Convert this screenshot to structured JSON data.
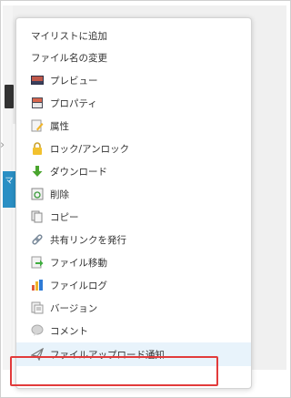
{
  "background": {
    "side_tab_label": "マ"
  },
  "menu": {
    "items": [
      {
        "label": "マイリストに追加",
        "icon": "none"
      },
      {
        "label": "ファイル名の変更",
        "icon": "none"
      },
      {
        "label": "プレビュー",
        "icon": "preview-icon"
      },
      {
        "label": "プロパティ",
        "icon": "properties-icon"
      },
      {
        "label": "属性",
        "icon": "attribute-icon"
      },
      {
        "label": "ロック/アンロック",
        "icon": "lock-icon"
      },
      {
        "label": "ダウンロード",
        "icon": "download-icon"
      },
      {
        "label": "削除",
        "icon": "delete-icon"
      },
      {
        "label": "コピー",
        "icon": "copy-icon"
      },
      {
        "label": "共有リンクを発行",
        "icon": "link-icon"
      },
      {
        "label": "ファイル移動",
        "icon": "move-icon"
      },
      {
        "label": "ファイルログ",
        "icon": "log-icon"
      },
      {
        "label": "バージョン",
        "icon": "version-icon"
      },
      {
        "label": "コメント",
        "icon": "comment-icon"
      },
      {
        "label": "ファイルアップロード通知",
        "icon": "upload-notify-icon"
      }
    ],
    "highlighted_index": 14,
    "highlight_color": "#e23b3b",
    "hover_bg": "#e8f3fb"
  }
}
